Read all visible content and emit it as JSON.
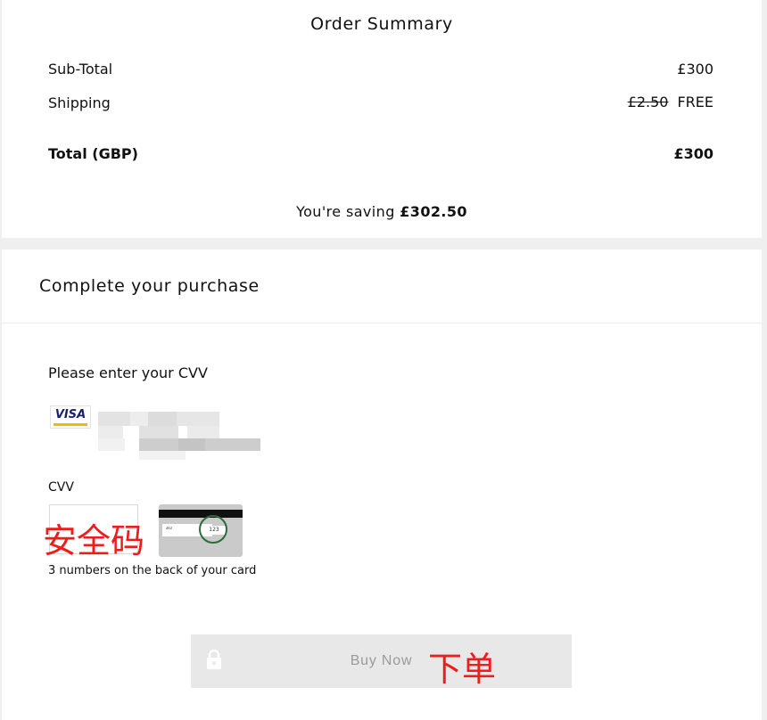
{
  "order_summary": {
    "title": "Order Summary",
    "subtotal_label": "Sub-Total",
    "subtotal_value": "£300",
    "shipping_label": "Shipping",
    "shipping_original": "£2.50",
    "shipping_value": "FREE",
    "total_label": "Total (GBP)",
    "total_value": "£300",
    "saving_prefix": "You're saving",
    "saving_amount": "£302.50"
  },
  "purchase": {
    "title": "Complete your purchase",
    "cvv_prompt": "Please enter your CVV",
    "card_brand": "VISA",
    "cvv_label": "CVV",
    "cvv_value": "",
    "cvv_annotation": "安全码",
    "cvv_help": "3 numbers on the back of your card",
    "cvv_example": "123",
    "buy_label": "Buy Now",
    "buy_annotation": "下单"
  },
  "colors": {
    "background": "#efefef",
    "visa_blue": "#1a1f71",
    "visa_gold": "#f7b600",
    "annotation_red": "#ef1c1c",
    "cvv_circle": "#2e6b3c",
    "button_bg": "#e8e8e8"
  },
  "icons": [
    "visa-icon",
    "card-back-icon",
    "lock-icon"
  ]
}
